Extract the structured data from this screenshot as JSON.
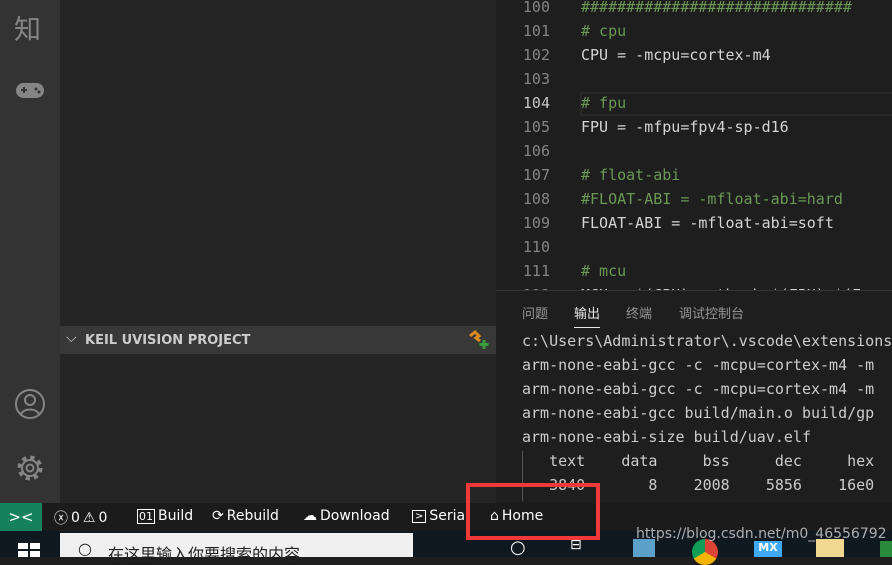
{
  "activity_bar": {
    "zhihu_glyph": "知",
    "icons": [
      "zhihu-icon",
      "gamepad-icon",
      "account-icon",
      "gear-icon"
    ]
  },
  "sidebar": {
    "section_title": "KEIL UVISION PROJECT"
  },
  "editor": {
    "current_line": 104,
    "lines": [
      {
        "n": "100",
        "text": "##############################",
        "comment": true
      },
      {
        "n": "101",
        "text": "# cpu",
        "comment": true
      },
      {
        "n": "102",
        "text": "CPU = -mcpu=cortex-m4",
        "comment": false
      },
      {
        "n": "103",
        "text": "",
        "comment": false
      },
      {
        "n": "104",
        "text": "# fpu",
        "comment": true
      },
      {
        "n": "105",
        "text": "FPU = -mfpu=fpv4-sp-d16",
        "comment": false
      },
      {
        "n": "106",
        "text": "",
        "comment": false
      },
      {
        "n": "107",
        "text": "# float-abi",
        "comment": true
      },
      {
        "n": "108",
        "text": "#FLOAT-ABI = -mfloat-abi=hard",
        "comment": true
      },
      {
        "n": "109",
        "text": "FLOAT-ABI = -mfloat-abi=soft",
        "comment": false
      },
      {
        "n": "110",
        "text": "",
        "comment": false
      },
      {
        "n": "111",
        "text": "# mcu",
        "comment": true
      },
      {
        "n": "112",
        "text": "MCU = $(CPU) -mthumb $(FPU) $(F",
        "comment": false
      }
    ]
  },
  "panel": {
    "tabs": [
      "问题",
      "输出",
      "终端",
      "调试控制台"
    ],
    "active_tab": "输出",
    "output": [
      "c:\\Users\\Administrator\\.vscode\\extensions",
      "arm-none-eabi-gcc -c -mcpu=cortex-m4 -m",
      "arm-none-eabi-gcc -c -mcpu=cortex-m4 -m",
      "arm-none-eabi-gcc build/main.o build/gp",
      "arm-none-eabi-size build/uav.elf",
      "   text    data     bss     dec     hex",
      "   3840       8    2008    5856    16e0"
    ]
  },
  "status_bar": {
    "errors": "0",
    "warnings": "0",
    "build": "Build",
    "rebuild": "Rebuild",
    "download": "Download",
    "serial": "Serial",
    "home": "Home",
    "accent": "#16825d",
    "highlight_color": "#f03a3a"
  },
  "taskbar": {
    "search_placeholder": "在这里输入你要搜索的内容",
    "watermark": "https://blog.csdn.net/m0_46556792"
  }
}
